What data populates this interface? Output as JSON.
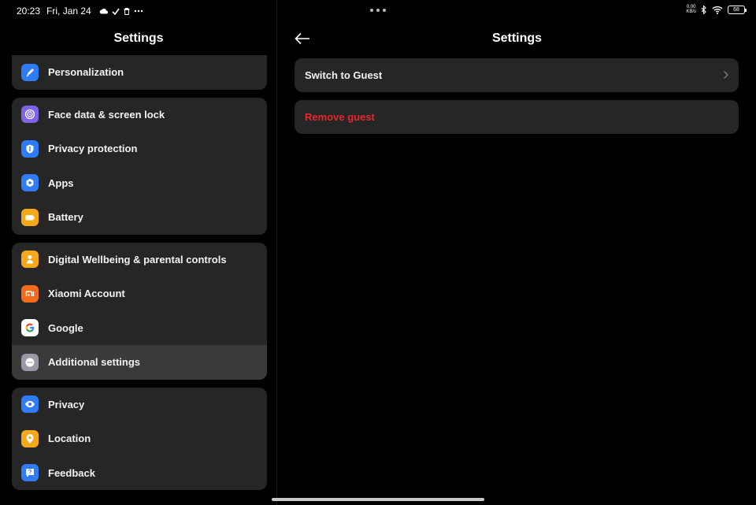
{
  "status_bar": {
    "time": "20:23",
    "date": "Fri, Jan 24",
    "net_speed_value": "0.00",
    "net_speed_unit": "KB/s",
    "battery": "68"
  },
  "left_pane": {
    "title": "Settings",
    "groups": [
      {
        "items": [
          {
            "label": "Personalization",
            "icon": "brush-icon",
            "color": "#2f7cf6"
          }
        ]
      },
      {
        "items": [
          {
            "label": "Face data & screen lock",
            "icon": "face-lock-icon",
            "color": "#7f63e8"
          },
          {
            "label": "Privacy protection",
            "icon": "shield-icon",
            "color": "#2f7cf6"
          },
          {
            "label": "Apps",
            "icon": "apps-gear-icon",
            "color": "#2f7cf6"
          },
          {
            "label": "Battery",
            "icon": "battery-icon",
            "color": "#f4a81a"
          }
        ]
      },
      {
        "items": [
          {
            "label": "Digital Wellbeing & parental controls",
            "icon": "wellbeing-icon",
            "color": "#f4a81a"
          },
          {
            "label": "Xiaomi Account",
            "icon": "xiaomi-mi-icon",
            "color": "#f26b1d"
          },
          {
            "label": "Google",
            "icon": "google-icon",
            "color": "#ffffff"
          },
          {
            "label": "Additional settings",
            "icon": "more-dots-icon",
            "color": "#9a9aa6",
            "selected": true
          }
        ]
      },
      {
        "items": [
          {
            "label": "Privacy",
            "icon": "eye-icon",
            "color": "#2f7cf6"
          },
          {
            "label": "Location",
            "icon": "location-pin-icon",
            "color": "#f4a81a"
          },
          {
            "label": "Feedback",
            "icon": "feedback-icon",
            "color": "#2f7cf6"
          }
        ]
      }
    ]
  },
  "right_pane": {
    "title": "Settings",
    "switch_to_guest": "Switch to Guest",
    "remove_guest": "Remove guest",
    "remove_color": "#e8262c"
  }
}
